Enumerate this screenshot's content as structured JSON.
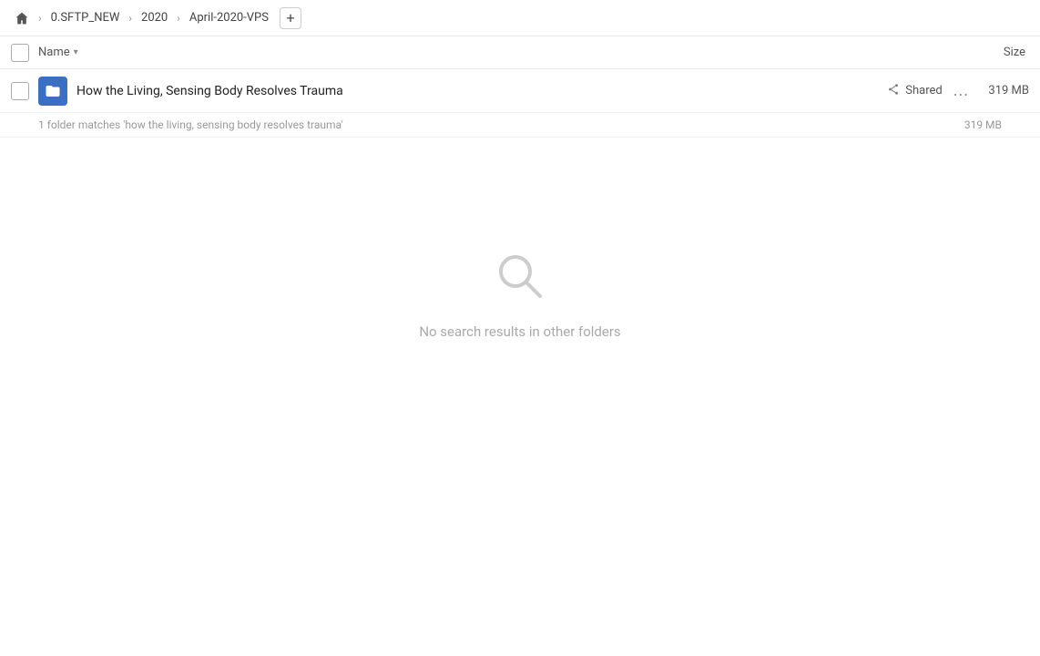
{
  "breadcrumb": {
    "home_icon": "home",
    "items": [
      {
        "label": "0.SFTP_NEW"
      },
      {
        "label": "2020"
      },
      {
        "label": "April-2020-VPS"
      }
    ],
    "add_icon": "+"
  },
  "columns": {
    "name_label": "Name",
    "size_label": "Size"
  },
  "file_row": {
    "icon_type": "folder-link",
    "name": "How the Living, Sensing Body Resolves Trauma",
    "shared_label": "Shared",
    "more_icon": "...",
    "size": "319 MB"
  },
  "match_info": {
    "text": "1 folder matches 'how the living, sensing body resolves trauma'",
    "size": "319 MB"
  },
  "no_results": {
    "icon": "search",
    "text": "No search results in other folders"
  }
}
